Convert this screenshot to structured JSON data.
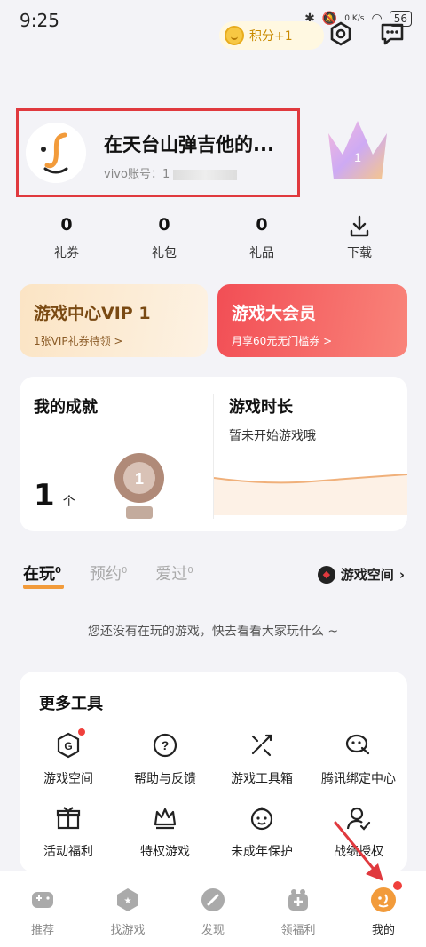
{
  "status_bar": {
    "time": "9:25",
    "net_speed": "0 K/s",
    "battery": "56"
  },
  "header": {
    "points_label": "积分+1"
  },
  "profile": {
    "nickname": "在天台山弹吉他的...",
    "account_label": "vivo账号: 1⁵",
    "account_visible": "vivo账号：1"
  },
  "stats": [
    {
      "num": "0",
      "label": "礼券"
    },
    {
      "num": "0",
      "label": "礼包"
    },
    {
      "num": "0",
      "label": "礼品"
    },
    {
      "num": "",
      "label": "下载"
    }
  ],
  "vip": {
    "title": "游戏中心VIP 1",
    "sub": "1张VIP礼券待领 >"
  },
  "member": {
    "title": "游戏大会员",
    "sub": "月享60元无门槛券 >"
  },
  "achievement": {
    "title": "我的成就",
    "count": "1",
    "unit": "个",
    "badge_num": "1"
  },
  "play_time": {
    "title": "游戏时长",
    "sub": "暂未开始游戏哦"
  },
  "tabs": [
    {
      "label": "在玩",
      "count": "0"
    },
    {
      "label": "预约",
      "count": "0"
    },
    {
      "label": "爱过",
      "count": "0"
    }
  ],
  "space_link": "游戏空间",
  "empty_note": "您还没有在玩的游戏，快去看看大家玩什么 ~",
  "tools": {
    "title": "更多工具",
    "items": [
      {
        "label": "游戏空间",
        "icon": "game-space-icon"
      },
      {
        "label": "帮助与反馈",
        "icon": "help-icon"
      },
      {
        "label": "游戏工具箱",
        "icon": "toolbox-icon"
      },
      {
        "label": "腾讯绑定中心",
        "icon": "tencent-bind-icon"
      },
      {
        "label": "活动福利",
        "icon": "gift-box-icon"
      },
      {
        "label": "特权游戏",
        "icon": "crown-icon"
      },
      {
        "label": "未成年保护",
        "icon": "child-protect-icon"
      },
      {
        "label": "战绩授权",
        "icon": "user-auth-icon"
      }
    ]
  },
  "bottom_nav": [
    {
      "label": "推荐",
      "icon": "gamepad-icon"
    },
    {
      "label": "找游戏",
      "icon": "find-game-icon"
    },
    {
      "label": "发现",
      "icon": "discover-icon"
    },
    {
      "label": "领福利",
      "icon": "welfare-icon"
    },
    {
      "label": "我的",
      "icon": "me-icon"
    }
  ],
  "colors": {
    "accent_red": "#e0393e",
    "accent_orange": "#f29b3b",
    "gold": "#c98a00"
  }
}
